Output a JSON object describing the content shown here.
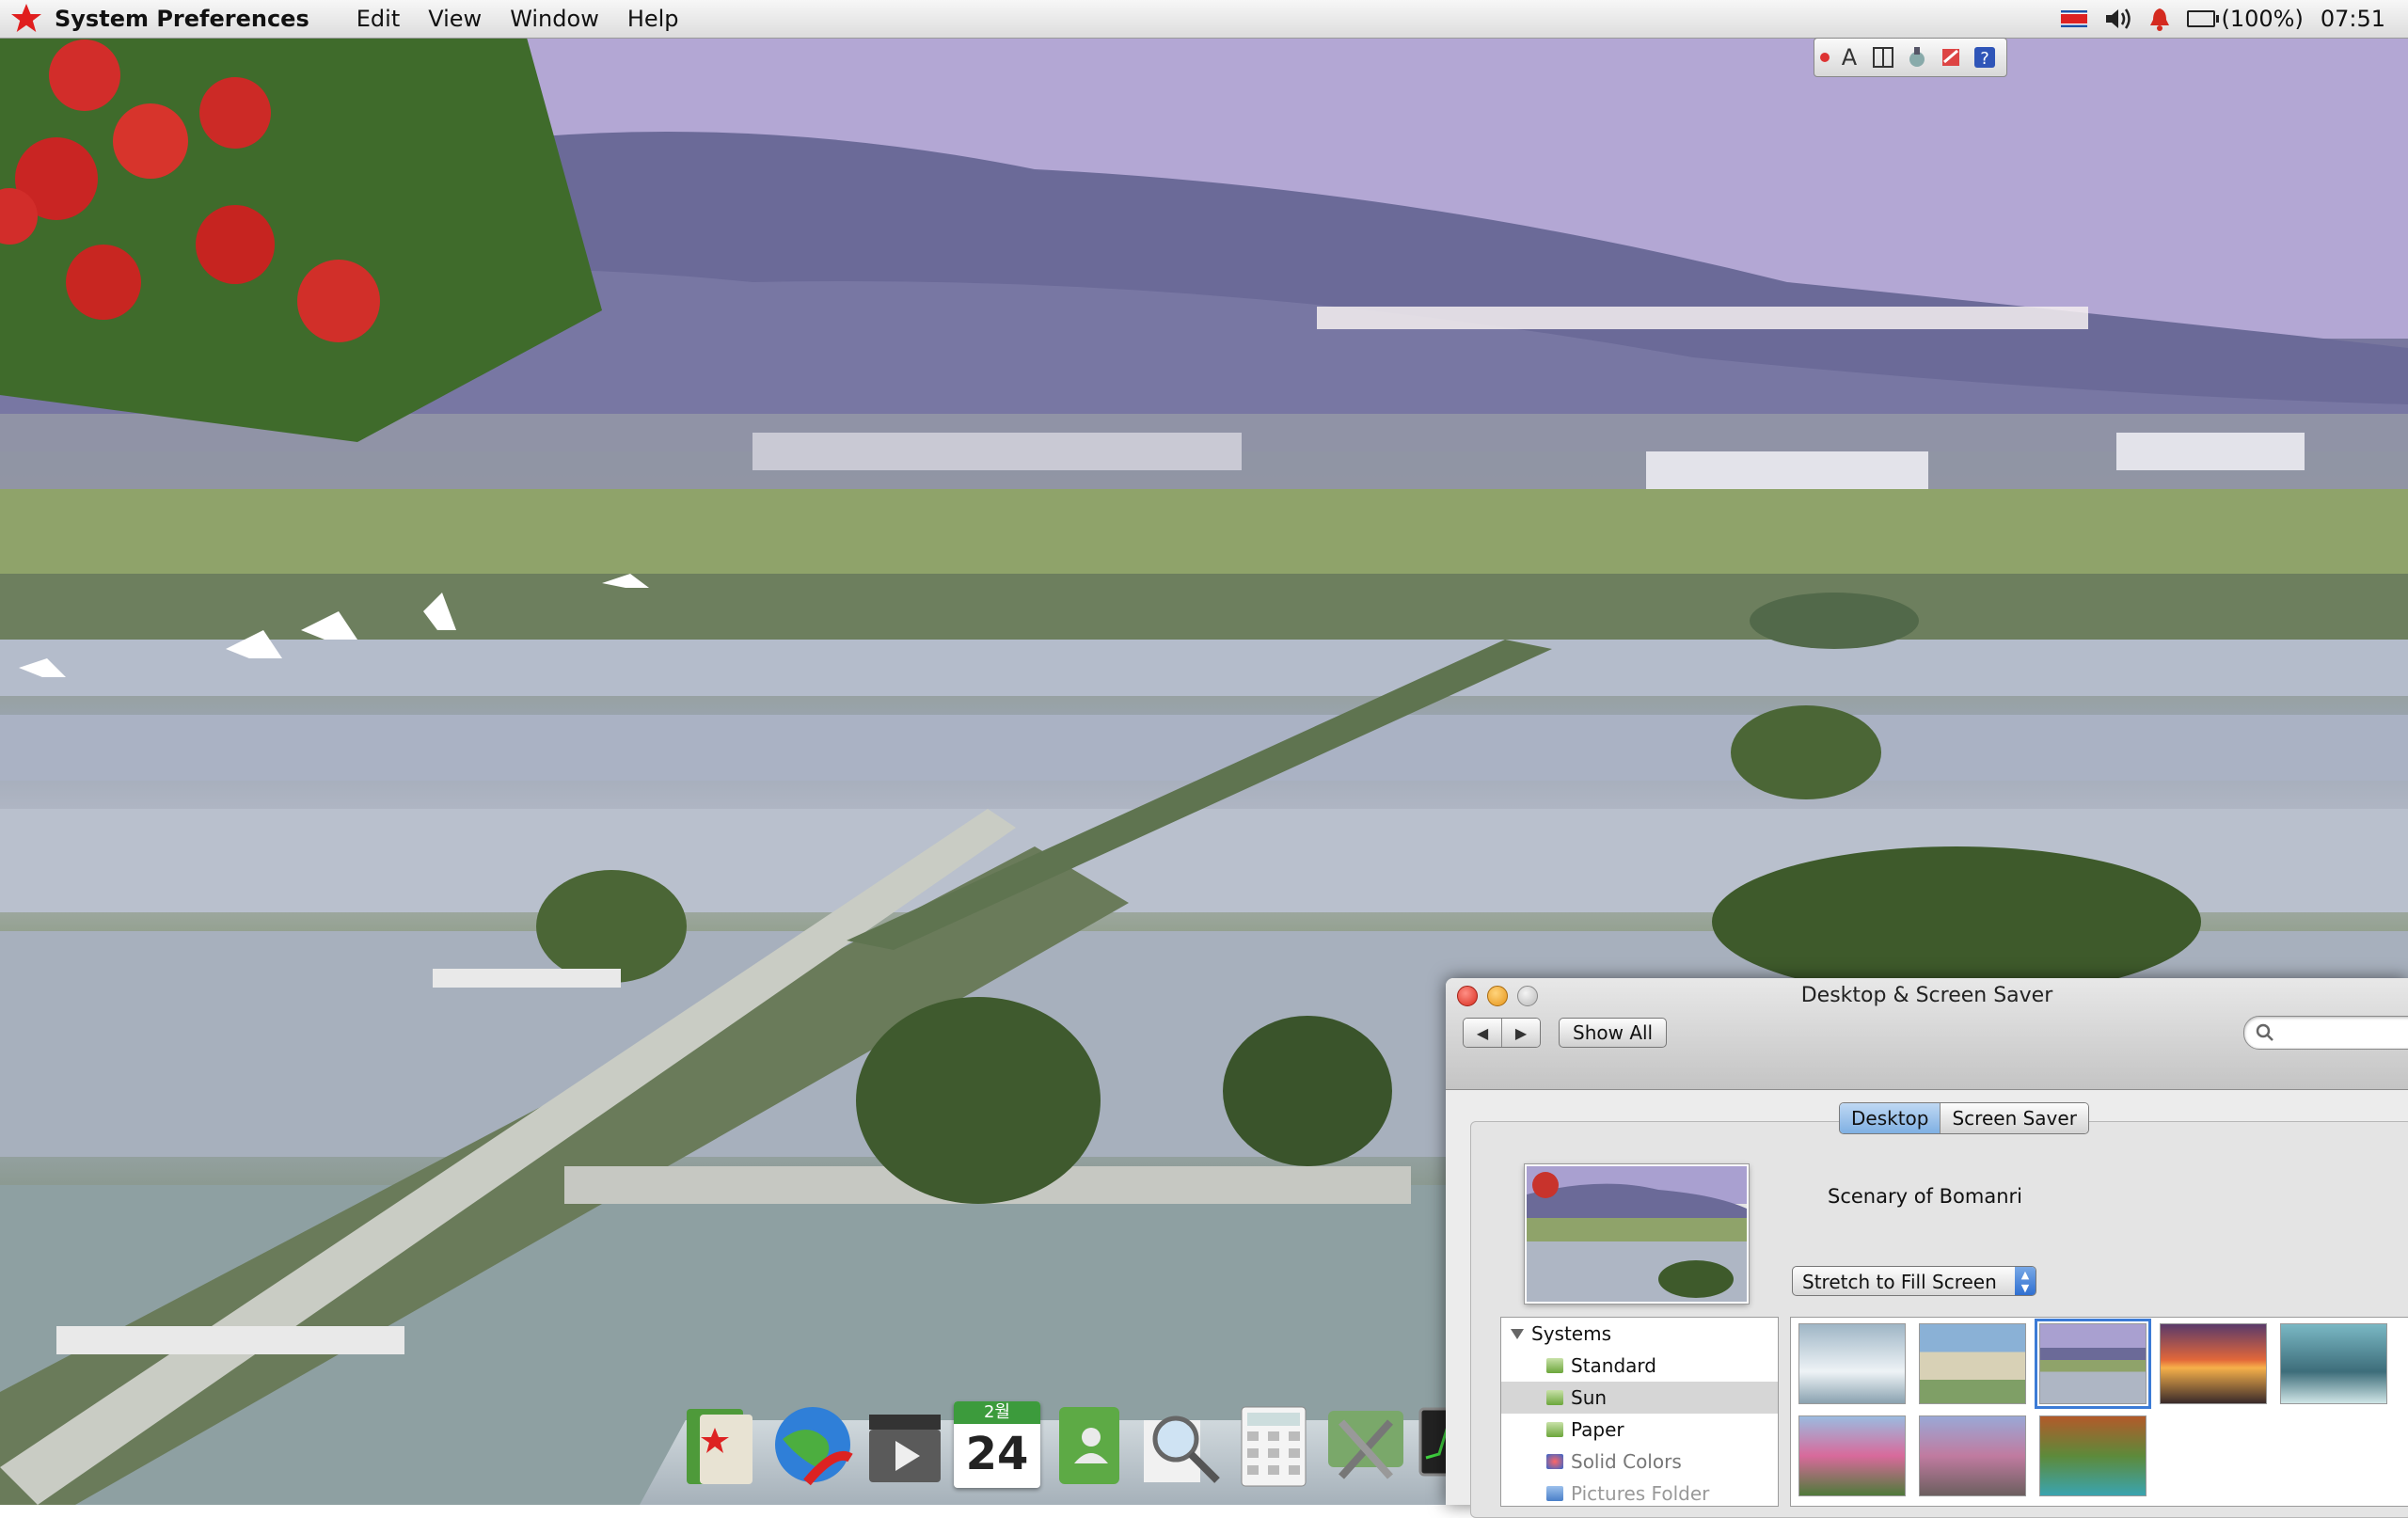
{
  "menubar": {
    "app_name": "System Preferences",
    "menus": [
      "Edit",
      "View",
      "Window",
      "Help"
    ],
    "battery": "(100%)",
    "clock": "07:51"
  },
  "window": {
    "title": "Desktop & Screen Saver",
    "show_all": "Show All",
    "search_placeholder": "",
    "tabs": [
      "Desktop",
      "Screen Saver"
    ],
    "active_tab": "Desktop",
    "picture_name": "Scenary of Bomanri",
    "fit_option": "Stretch to Fill Screen",
    "source_list": [
      {
        "label": "Systems",
        "type": "group"
      },
      {
        "label": "Standard",
        "type": "item"
      },
      {
        "label": "Sun",
        "type": "item"
      },
      {
        "label": "Paper",
        "type": "item"
      },
      {
        "label": "Solid Colors",
        "type": "item"
      },
      {
        "label": "Pictures Folder",
        "type": "item"
      }
    ],
    "thumbnails_count": 8,
    "selected_thumbnail": 3
  },
  "palette": {
    "letter": "A"
  },
  "dock": {
    "icons": [
      "red-star-book-icon",
      "globe-browser-icon",
      "media-player-icon",
      "calendar-icon",
      "address-book-icon",
      "search-magnifier-icon",
      "calculator-icon",
      "utilities-icon",
      "activity-monitor-icon",
      "cup-icon",
      "trash-icon"
    ],
    "calendar_month": "2월",
    "calendar_day": "24"
  },
  "colors": {
    "accent_blue": "#3c7bd6",
    "menu_star": "#e01e1e"
  }
}
